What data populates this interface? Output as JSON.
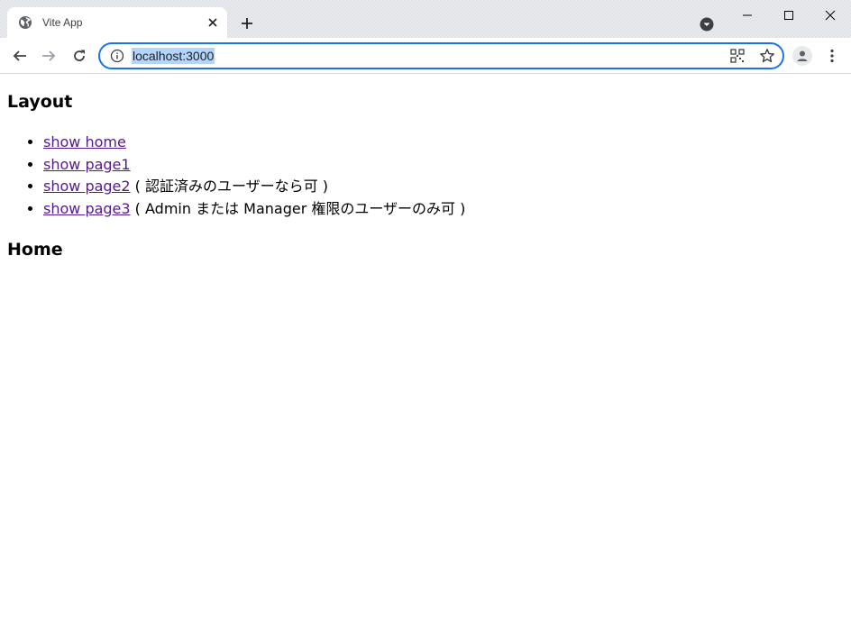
{
  "browser": {
    "tab_title": "Vite App",
    "url": "localhost:3000"
  },
  "icons": {
    "tab": "globe-icon",
    "close": "close-icon",
    "newtab": "plus-icon",
    "back": "back-arrow-icon",
    "forward": "forward-arrow-icon",
    "reload": "reload-icon",
    "info": "info-icon",
    "qr": "qr-code-icon",
    "star": "star-icon",
    "profile": "profile-icon",
    "menu": "kebab-menu-icon"
  },
  "colors": {
    "omnibox_focus": "#1a73e8",
    "visited_link": "#551a8b",
    "selection": "#b3d4fc"
  },
  "page": {
    "layout_title": "Layout",
    "links": [
      {
        "label": "show home",
        "note": ""
      },
      {
        "label": "show page1",
        "note": ""
      },
      {
        "label": "show page2",
        "note": " ( 認証済みのユーザーなら可 )"
      },
      {
        "label": "show page3",
        "note": " ( Admin または Manager 権限のユーザーのみ可 )"
      }
    ],
    "home_title": "Home"
  }
}
